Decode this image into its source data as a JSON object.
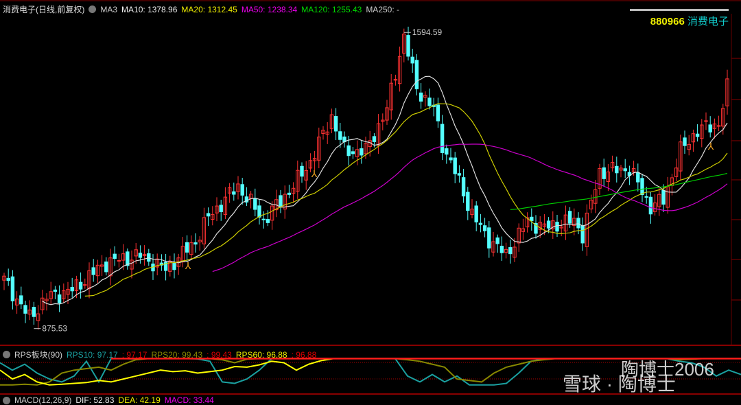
{
  "header": {
    "title": "消费电子(日线,前复权)",
    "ma3": "MA3",
    "ma10": "MA10: 1378.96",
    "ma20": "MA20: 1312.45",
    "ma50": "MA50: 1238.34",
    "ma120": "MA120: 1255.43",
    "ma250": "MA250: -"
  },
  "security": {
    "code": "880966",
    "name": "消费电子"
  },
  "rps": {
    "title": "RPS板块(90)",
    "rps10": "RPS10: 97.17",
    "rps10b": ": 97.17",
    "rps20": "RPS20: 99.43",
    "rps20b": ": 99.43",
    "rps60": "RPS60: 96.88",
    "rps60b": ": 96.88"
  },
  "macd": {
    "title": "MACD(12,26,9)",
    "dif": "DIF: 52.83",
    "dea": "DEA: 42.19",
    "macd": "MACD: 33.44"
  },
  "watermark": {
    "line1": "陶博士2006",
    "line2": "雪球 · 陶博士"
  },
  "colors": {
    "up": "#ff3232",
    "down": "#54ffff",
    "ma10": "#dddddd",
    "ma20": "#cccc00",
    "ma50": "#cc00cc",
    "ma120": "#00cc00"
  },
  "chart_data": {
    "type": "candlestick",
    "title": "消费电子(日线,前复权)",
    "ylim": [
      840,
      1640
    ],
    "high_label": "1594.59",
    "low_label": "875.53",
    "close_keypoints": [
      [
        0,
        994
      ],
      [
        6,
        901
      ],
      [
        10,
        952
      ],
      [
        16,
        969
      ],
      [
        24,
        1036
      ],
      [
        32,
        1053
      ],
      [
        38,
        1019
      ],
      [
        45,
        1087
      ],
      [
        48,
        1146
      ],
      [
        55,
        1222
      ],
      [
        61,
        1138
      ],
      [
        68,
        1222
      ],
      [
        72,
        1281
      ],
      [
        77,
        1391
      ],
      [
        80,
        1307
      ],
      [
        85,
        1307
      ],
      [
        90,
        1408
      ],
      [
        94,
        1586
      ],
      [
        97,
        1459
      ],
      [
        101,
        1408
      ],
      [
        103,
        1323
      ],
      [
        106,
        1256
      ],
      [
        110,
        1154
      ],
      [
        113,
        1104
      ],
      [
        118,
        1053
      ],
      [
        123,
        1138
      ],
      [
        127,
        1121
      ],
      [
        134,
        1138
      ],
      [
        136,
        1104
      ],
      [
        140,
        1256
      ],
      [
        147,
        1264
      ],
      [
        152,
        1171
      ],
      [
        155,
        1188
      ],
      [
        159,
        1307
      ],
      [
        163,
        1357
      ],
      [
        168,
        1374
      ],
      [
        170,
        1459
      ]
    ],
    "rps_series": [
      {
        "name": "RPS10",
        "color": "#1aa0a0",
        "values": [
          85,
          60,
          80,
          50,
          30,
          20,
          40,
          90,
          20,
          99,
          99,
          98,
          99,
          99,
          99,
          99,
          98,
          90,
          20,
          15,
          30,
          60,
          99,
          99,
          99,
          99,
          99,
          99,
          99,
          99,
          99,
          99,
          99,
          40,
          20,
          45,
          20,
          40,
          10,
          10,
          10,
          15,
          50,
          90,
          99,
          99,
          99,
          99,
          99,
          99,
          99,
          99,
          99,
          99,
          99,
          90,
          85,
          70,
          40,
          60,
          45
        ]
      },
      {
        "name": "RPS20",
        "color": "#888800",
        "values": [
          10,
          10,
          12,
          10,
          20,
          50,
          60,
          65,
          70,
          60,
          80,
          95,
          99,
          99,
          99,
          99,
          99,
          99,
          95,
          85,
          97,
          99,
          99,
          99,
          99,
          99,
          99,
          99,
          99,
          99,
          99,
          99,
          99,
          95,
          90,
          80,
          70,
          30,
          25,
          20,
          50,
          70,
          80,
          90,
          95,
          99,
          99,
          99,
          99,
          99,
          99,
          99,
          99,
          99,
          99,
          95,
          97,
          99,
          99,
          99,
          99
        ]
      },
      {
        "name": "RPS60",
        "color": "#ffff00",
        "values": [
          60,
          30,
          45,
          20,
          10,
          12,
          15,
          18,
          25,
          20,
          30,
          40,
          50,
          60,
          55,
          58,
          50,
          55,
          60,
          72,
          70,
          78,
          90,
          85,
          60,
          80,
          92,
          99,
          99,
          99,
          99,
          99,
          99,
          99,
          99,
          99,
          99,
          99,
          99,
          99,
          99,
          99,
          99,
          99,
          99,
          99,
          99,
          99,
          99,
          99,
          99,
          99,
          99,
          99,
          99,
          99,
          99,
          99,
          99,
          99,
          99
        ]
      },
      {
        "name": "RPS",
        "color": "#ff1a1a",
        "values": [
          null,
          null,
          null,
          null,
          null,
          null,
          null,
          null,
          null,
          99,
          99,
          99,
          99,
          99,
          99,
          99,
          99,
          99,
          99,
          99,
          99,
          99,
          99,
          99,
          99,
          99,
          99,
          99,
          99,
          99,
          99,
          99,
          99,
          99,
          99,
          99,
          99,
          99,
          99,
          99,
          99,
          99,
          99,
          99,
          99,
          99,
          99,
          99,
          99,
          99,
          99,
          99,
          99,
          99,
          99,
          99,
          99,
          99,
          99,
          99,
          99
        ]
      }
    ]
  }
}
